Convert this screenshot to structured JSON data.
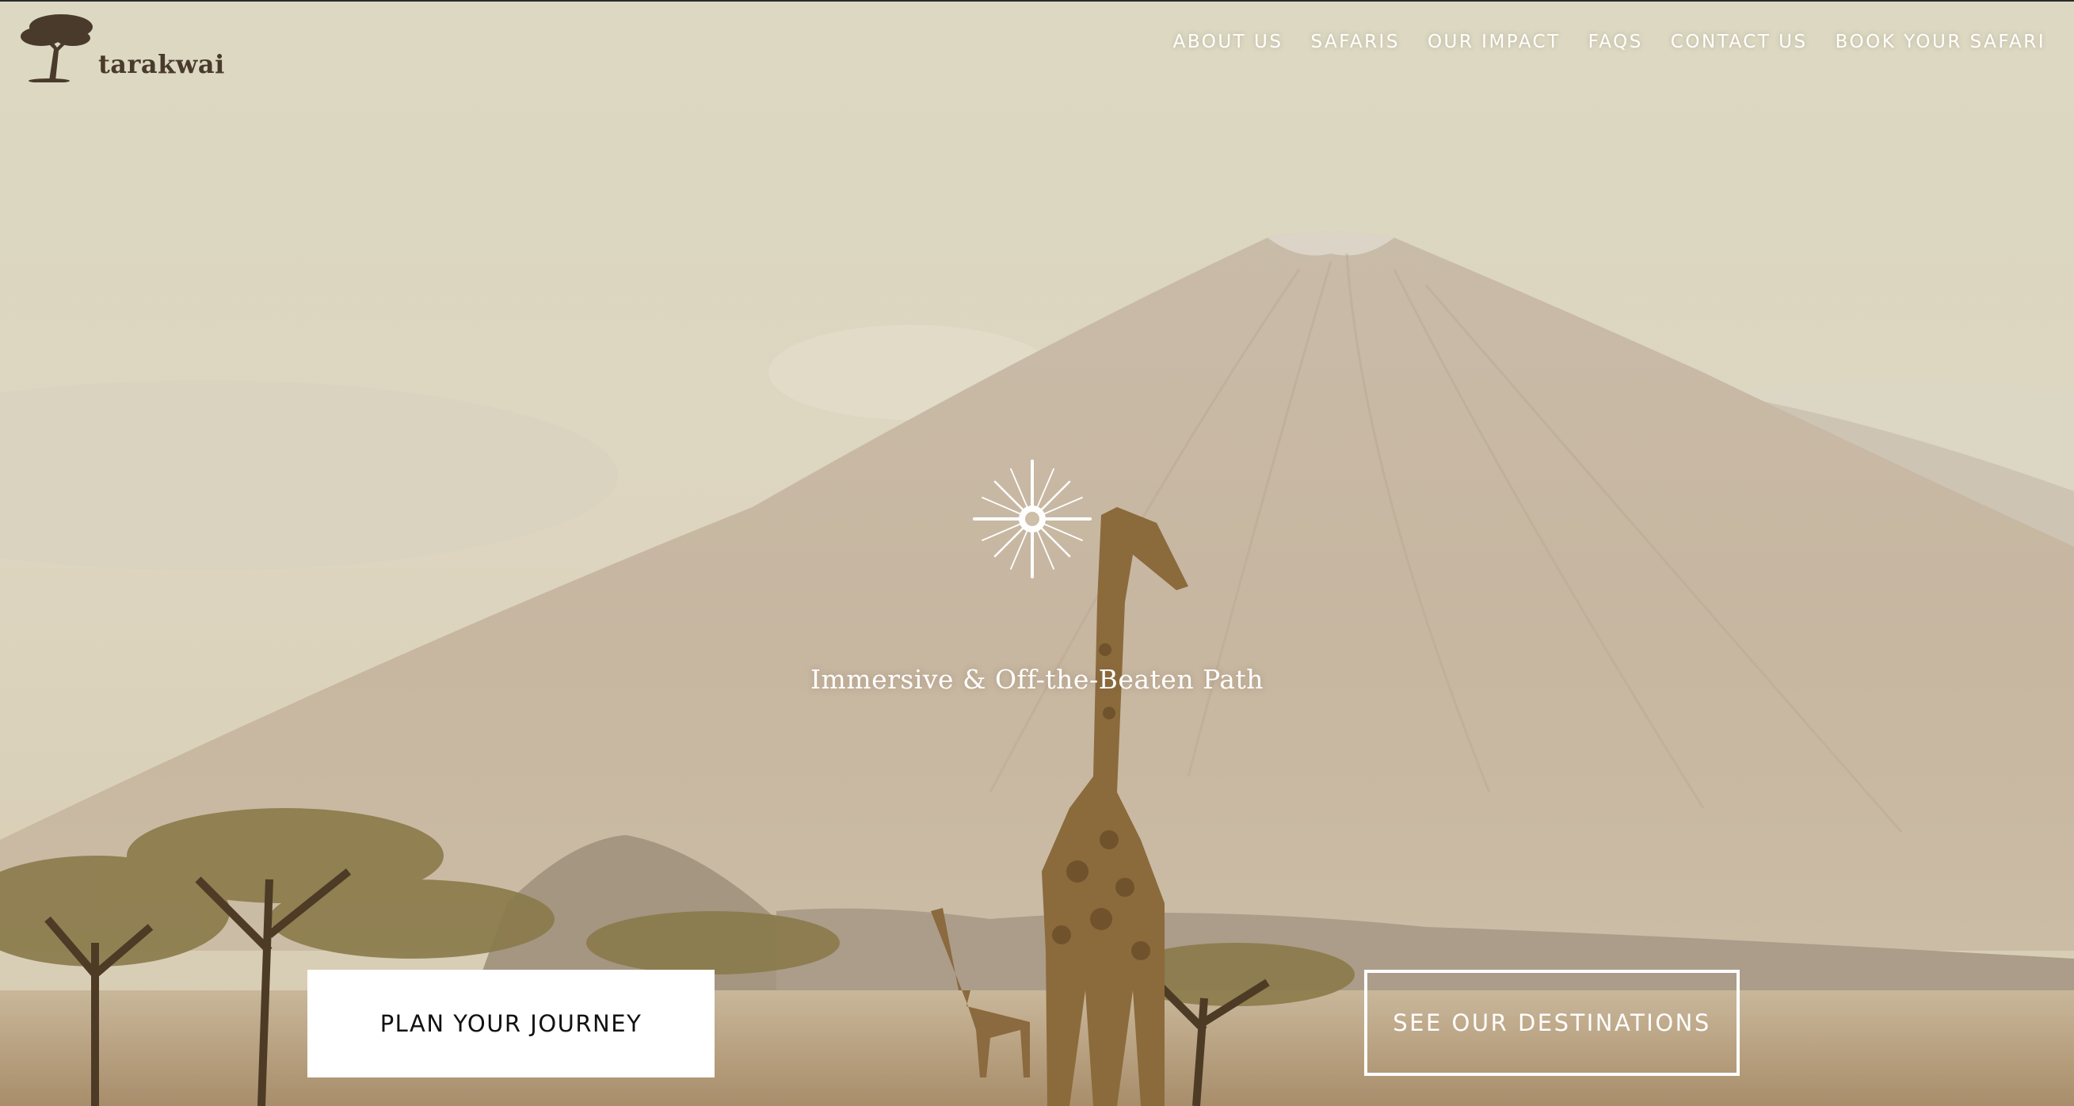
{
  "brand": {
    "name": "tarakwai"
  },
  "nav": {
    "items": [
      {
        "label": "ABOUT US"
      },
      {
        "label": "SAFARIS"
      },
      {
        "label": "OUR IMPACT"
      },
      {
        "label": "FAQS"
      },
      {
        "label": "CONTACT US"
      },
      {
        "label": "BOOK YOUR SAFARI"
      }
    ]
  },
  "hero": {
    "tagline": "Immersive & Off-the-Beaten Path",
    "primary_cta": "PLAN YOUR JOURNEY",
    "secondary_cta": "SEE OUR DESTINATIONS",
    "icon": "sun-compass-icon"
  },
  "colors": {
    "nav_text": "#ffffff",
    "logo": "#4a3a2c",
    "primary_button_bg": "#ffffff",
    "primary_button_text": "#111111",
    "secondary_button_border": "#ffffff"
  }
}
